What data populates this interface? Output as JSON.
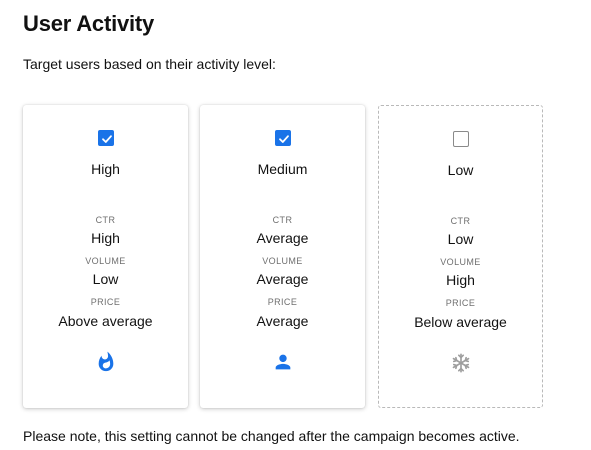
{
  "header": {
    "title": "User Activity",
    "subtitle": "Target users based on their activity level:"
  },
  "cards": [
    {
      "level": "High",
      "checked": true,
      "icon": "fire-icon",
      "metrics": [
        {
          "label": "CTR",
          "value": "High"
        },
        {
          "label": "VOLUME",
          "value": "Low"
        },
        {
          "label": "PRICE",
          "value": "Above average"
        }
      ]
    },
    {
      "level": "Medium",
      "checked": true,
      "icon": "person-icon",
      "metrics": [
        {
          "label": "CTR",
          "value": "Average"
        },
        {
          "label": "VOLUME",
          "value": "Average"
        },
        {
          "label": "PRICE",
          "value": "Average"
        }
      ]
    },
    {
      "level": "Low",
      "checked": false,
      "icon": "snowflake-icon",
      "metrics": [
        {
          "label": "CTR",
          "value": "Low"
        },
        {
          "label": "VOLUME",
          "value": "High"
        },
        {
          "label": "PRICE",
          "value": "Below average"
        }
      ]
    }
  ],
  "footer": {
    "note": "Please note, this setting cannot be changed after the campaign becomes active."
  },
  "colors": {
    "accent": "#1a73e8",
    "muted_icon": "#9e9e9e"
  }
}
